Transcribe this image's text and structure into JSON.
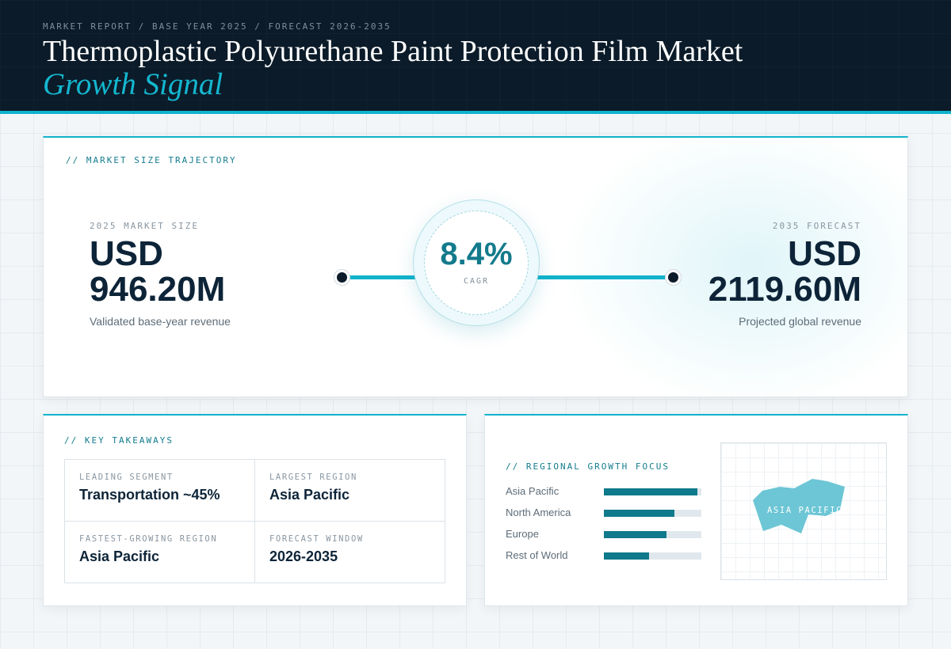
{
  "header": {
    "kicker": "MARKET REPORT / BASE YEAR 2025 / FORECAST 2026-2035",
    "title": "Thermoplastic Polyurethane Paint Protection Film Market",
    "title_accent": "Growth Signal"
  },
  "trajectory": {
    "label": "// MARKET SIZE TRAJECTORY",
    "start": {
      "caption": "2025 MARKET SIZE",
      "currency": "USD",
      "value": "946.20M",
      "subtext": "Validated base-year revenue"
    },
    "end": {
      "caption": "2035 FORECAST",
      "currency": "USD",
      "value": "2119.60M",
      "subtext": "Projected global revenue"
    },
    "cagr": {
      "value": "8.4%",
      "label": "CAGR"
    }
  },
  "takeaways": {
    "label": "// KEY TAKEAWAYS",
    "items": [
      {
        "caption": "LEADING SEGMENT",
        "value": "Transportation ~45%"
      },
      {
        "caption": "LARGEST REGION",
        "value": "Asia Pacific"
      },
      {
        "caption": "FASTEST-GROWING REGION",
        "value": "Asia Pacific"
      },
      {
        "caption": "FORECAST WINDOW",
        "value": "2026-2035"
      }
    ]
  },
  "regional": {
    "label": "// REGIONAL GROWTH FOCUS",
    "bars": [
      {
        "name": "Asia Pacific",
        "level": 0.96
      },
      {
        "name": "North America",
        "level": 0.72
      },
      {
        "name": "Europe",
        "level": 0.64
      },
      {
        "name": "Rest of World",
        "level": 0.46
      }
    ],
    "map_label": "ASIA PACIFIC"
  },
  "colors": {
    "accent": "#11b3cc",
    "header_bg": "#0b1b29",
    "bar_fill": "#0f7a8b",
    "map_shape": "#6cc6d5"
  }
}
